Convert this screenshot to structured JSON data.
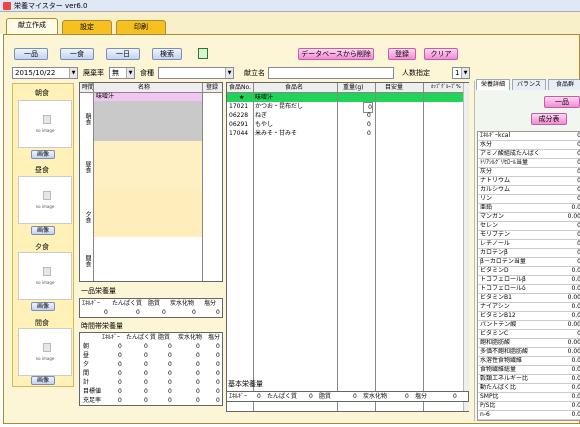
{
  "window": {
    "title": "栄養マイスター ver6.0"
  },
  "tabs": [
    {
      "label": "献立作成"
    },
    {
      "label": "設定"
    },
    {
      "label": "印刷"
    }
  ],
  "toolbar": {
    "ippin": "一品",
    "isshoku": "一食",
    "ichinichi": "一日",
    "search": "検索",
    "delete_db": "データベースから削除",
    "register": "登録",
    "clear": "クリア"
  },
  "filters": {
    "date": "2015/10/22",
    "waste_label": "廃棄率",
    "waste_value": "無",
    "meal_label": "食種",
    "meal_value": "",
    "menu_name_label": "献立名",
    "menu_name_value": "",
    "people_label": "人数指定",
    "people_value": "1"
  },
  "meals": [
    {
      "label": "朝食",
      "image_text": "no image",
      "button": "画像"
    },
    {
      "label": "昼食",
      "image_text": "no image",
      "button": "画像"
    },
    {
      "label": "夕食",
      "image_text": "no image",
      "button": "画像"
    },
    {
      "label": "間食",
      "image_text": "no image",
      "button": "画像"
    }
  ],
  "menu_table": {
    "headers": [
      "時間",
      "名称",
      "登録"
    ],
    "sections": [
      "朝食",
      "昼食",
      "夕食",
      "間食"
    ],
    "first_row_name": "味噌汁"
  },
  "ippin_nutrition": {
    "title": "一品栄養量",
    "headers": [
      "ｴﾈﾙｷﾞｰ",
      "たんぱく質",
      "脂質",
      "炭水化物",
      "塩分"
    ],
    "values": [
      "0",
      "0",
      "0",
      "0",
      "0"
    ]
  },
  "time_nutrition": {
    "title": "時間帯栄養量",
    "headers": [
      "",
      "ｴﾈﾙｷﾞｰ",
      "たんぱく質",
      "脂質",
      "炭水化物",
      "塩分"
    ],
    "rows": [
      {
        "label": "朝",
        "values": [
          "0",
          "0",
          "0",
          "0",
          "0"
        ]
      },
      {
        "label": "昼",
        "values": [
          "0",
          "0",
          "0",
          "0",
          "0"
        ]
      },
      {
        "label": "夕",
        "values": [
          "0",
          "0",
          "0",
          "0",
          "0"
        ]
      },
      {
        "label": "間",
        "values": [
          "0",
          "0",
          "0",
          "0",
          "0"
        ]
      },
      {
        "label": "計",
        "values": [
          "0",
          "0",
          "0",
          "0",
          "0"
        ]
      },
      {
        "label": "目標値",
        "values": [
          "0",
          "0",
          "0",
          "0",
          "0"
        ]
      },
      {
        "label": "充足率",
        "values": [
          "0",
          "0",
          "0",
          "0",
          "0"
        ]
      }
    ]
  },
  "food_table": {
    "headers": [
      "食品No.",
      "食品名",
      "重量(g)",
      "目安量",
      "ｶｯﾌﾟｸﾞﾙｰﾌﾟ%"
    ],
    "highlight": {
      "no": "★",
      "name": "味噌汁"
    },
    "rows": [
      {
        "no": "17021",
        "name": "かつお・昆布だし",
        "weight": "0"
      },
      {
        "no": "06228",
        "name": "ねぎ",
        "weight": "0"
      },
      {
        "no": "06291",
        "name": "もやし",
        "weight": "0"
      },
      {
        "no": "17044",
        "name": "米みそ・甘みそ",
        "weight": "0"
      }
    ]
  },
  "basic_nutrition": {
    "title": "基本栄養量",
    "items": [
      "ｴﾈﾙｷﾞｰ",
      "0",
      "たんぱく質",
      "0",
      "脂質",
      "0",
      "炭水化物",
      "0",
      "塩分",
      "0"
    ]
  },
  "right_panel": {
    "tabs": [
      "栄養詳細",
      "バランス",
      "食品群"
    ],
    "btn_ippin": "一品",
    "btn_seibun": "成分表",
    "nutrients": [
      {
        "name": "ｴﾈﾙｷﾞｰkcal",
        "value": "0"
      },
      {
        "name": "水分",
        "value": "0"
      },
      {
        "name": "アミノ酸組成たんぱく",
        "value": "0"
      },
      {
        "name": "ﾄﾘｱｼﾙｸﾞﾘｾﾛｰﾙ当量",
        "value": "0"
      },
      {
        "name": "灰分",
        "value": "0"
      },
      {
        "name": "ナトリウム",
        "value": "0"
      },
      {
        "name": "カルシウム",
        "value": "0"
      },
      {
        "name": "リン",
        "value": "0"
      },
      {
        "name": "亜鉛",
        "value": "0.0"
      },
      {
        "name": "マンガン",
        "value": "0.00"
      },
      {
        "name": "セレン",
        "value": "0"
      },
      {
        "name": "モリブデン",
        "value": "0"
      },
      {
        "name": "レチノール",
        "value": "0"
      },
      {
        "name": "カロテンβ",
        "value": "0"
      },
      {
        "name": "β－カロテン当量",
        "value": "0"
      },
      {
        "name": "ビタミンD",
        "value": "0.0"
      },
      {
        "name": "トコフェロールβ",
        "value": "0.0"
      },
      {
        "name": "トコフェロールδ",
        "value": "0.0"
      },
      {
        "name": "ビタミンB1",
        "value": "0.00"
      },
      {
        "name": "ナイアシン",
        "value": "0.0"
      },
      {
        "name": "ビタミンB12",
        "value": "0.0"
      },
      {
        "name": "パントテン酸",
        "value": "0.00"
      },
      {
        "name": "ビタミンC",
        "value": "0"
      },
      {
        "name": "飽和脂肪酸",
        "value": "0.00"
      },
      {
        "name": "多価不飽和脂肪酸",
        "value": "0.00"
      },
      {
        "name": "水溶性食物繊維",
        "value": "0.0"
      },
      {
        "name": "食物繊維総量",
        "value": "0.0"
      },
      {
        "name": "穀類エネルギー比",
        "value": "0.0"
      },
      {
        "name": "動たんぱく比",
        "value": "0.0"
      },
      {
        "name": "SMP比",
        "value": "0.0"
      },
      {
        "name": "P/S比",
        "value": "0.0"
      },
      {
        "name": "n-6",
        "value": "0.0"
      }
    ]
  }
}
